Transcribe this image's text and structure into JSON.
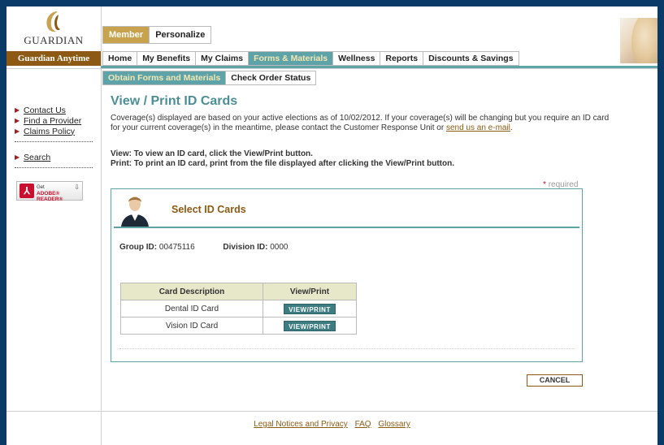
{
  "brand": {
    "logo_text": "GUARDIAN",
    "anytime": "Guardian Anytime",
    "accent": "#5ea3a7",
    "gold": "#8c5a14"
  },
  "top_tabs": [
    {
      "label": "Member",
      "active": true
    },
    {
      "label": "Personalize",
      "active": false
    }
  ],
  "nav": [
    {
      "label": "Home"
    },
    {
      "label": "My Benefits"
    },
    {
      "label": "My Claims"
    },
    {
      "label": "Forms & Materials",
      "active": true
    },
    {
      "label": "Wellness"
    },
    {
      "label": "Reports"
    },
    {
      "label": "Discounts & Savings"
    }
  ],
  "sub_tabs": [
    {
      "label": "Obtain Forms and Materials",
      "active": true
    },
    {
      "label": "Check Order Status"
    }
  ],
  "left_nav": {
    "links": [
      "Contact Us",
      "Find a Provider",
      "Claims Policy"
    ],
    "search": "Search",
    "adobe": {
      "get": "Get",
      "reader": "ADOBE® READER®"
    }
  },
  "main": {
    "title": "View / Print ID Cards",
    "para_text": "Coverage(s) displayed are based on your active elections as of 10/02/2012. If your coverage(s) will be changing but you require an ID card for your current coverage(s) in the meantime, please contact the Customer Response Unit or ",
    "para_link": "send us an e-mail",
    "para_end": ".",
    "view_instr": "View: To view an ID card, click the View/Print button.",
    "print_instr": "Print: To print an ID card, print from the file displayed after clicking the View/Print button.",
    "required_star": "*",
    "required": "required"
  },
  "panel": {
    "title": "Select ID Cards",
    "group_label": "Group ID:",
    "group_value": "00475116",
    "division_label": "Division ID:",
    "division_value": "0000",
    "columns": [
      "Card Description",
      "View/Print"
    ],
    "rows": [
      {
        "description": "Dental ID Card",
        "button": "VIEW/PRINT"
      },
      {
        "description": "Vision ID Card",
        "button": "VIEW/PRINT"
      }
    ]
  },
  "cancel_label": "CANCEL",
  "footer": [
    "Legal Notices and Privacy",
    "FAQ",
    "Glossary"
  ]
}
